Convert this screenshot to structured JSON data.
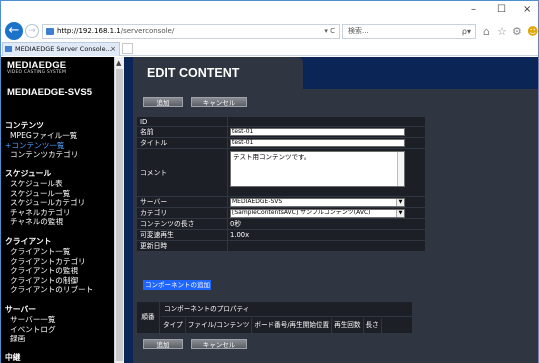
{
  "browser": {
    "url_host": "http://192.168.1.1",
    "url_path": "/serverconsole/",
    "address_controls": "▾ C",
    "search_placeholder": "検索...",
    "search_controls": "ρ▾",
    "tab_title": "MEDIAEDGE Server Console...",
    "tab_close": "×",
    "window_min": "–",
    "window_max": "☐",
    "window_close": "×"
  },
  "sidebar": {
    "logo_line1": "MEDIAEDGE",
    "logo_line2": "VIDEO CASTING SYSTEM",
    "server_name": "MEDIAEDGE-SVS5",
    "sections": [
      {
        "title": "コンテンツ",
        "items": [
          {
            "label": "MPEGファイル一覧",
            "active": false
          },
          {
            "label": "+コンテンツ一覧",
            "active": true
          },
          {
            "label": "コンテンツカテゴリ",
            "active": false
          }
        ]
      },
      {
        "title": "スケジュール",
        "items": [
          {
            "label": "スケジュール表",
            "active": false
          },
          {
            "label": "スケジュール一覧",
            "active": false
          },
          {
            "label": "スケジュールカテゴリ",
            "active": false
          },
          {
            "label": "チャネルカテゴリ",
            "active": false
          },
          {
            "label": "チャネルの監視",
            "active": false
          }
        ]
      },
      {
        "title": "クライアント",
        "items": [
          {
            "label": "クライアント一覧",
            "active": false
          },
          {
            "label": "クライアントカテゴリ",
            "active": false
          },
          {
            "label": "クライアントの監視",
            "active": false
          },
          {
            "label": "クライアントの制御",
            "active": false
          },
          {
            "label": "クライアントのリブート",
            "active": false
          }
        ]
      },
      {
        "title": "サーバー",
        "items": [
          {
            "label": "サーバー一覧",
            "active": false
          },
          {
            "label": "イベントログ",
            "active": false
          },
          {
            "label": "録画",
            "active": false
          }
        ]
      },
      {
        "title": "中継",
        "items": []
      }
    ]
  },
  "main": {
    "title": "EDIT CONTENT",
    "add_label": "追加",
    "cancel_label": "キャンセル",
    "fields": {
      "id_label": "ID",
      "id_value": "",
      "name_label": "名前",
      "name_value": "test-01",
      "title_label": "タイトル",
      "title_value": "test-01",
      "comment_label": "コメント",
      "comment_value": "テスト用コンテンツです。",
      "server_label": "サーバー",
      "server_value": "MEDIAEDGE-SVS",
      "category_label": "カテゴリ",
      "category_value": "[SampleContentsAVC] サンプルコンテンツ(AVC)",
      "length_label": "コンテンツの長さ",
      "length_value": "0秒",
      "speed_label": "可変速再生",
      "speed_value": "1.00x",
      "updated_label": "更新日時",
      "updated_value": ""
    },
    "add_component_link": "コンポーネントの追加",
    "component_table": {
      "index_header": "順番",
      "props_header": "コンポーネントのプロパティ",
      "columns": [
        "タイプ",
        "ファイル/コンテンツ",
        "ボード番号/再生開始位置",
        "再生回数",
        "長さ"
      ]
    }
  }
}
